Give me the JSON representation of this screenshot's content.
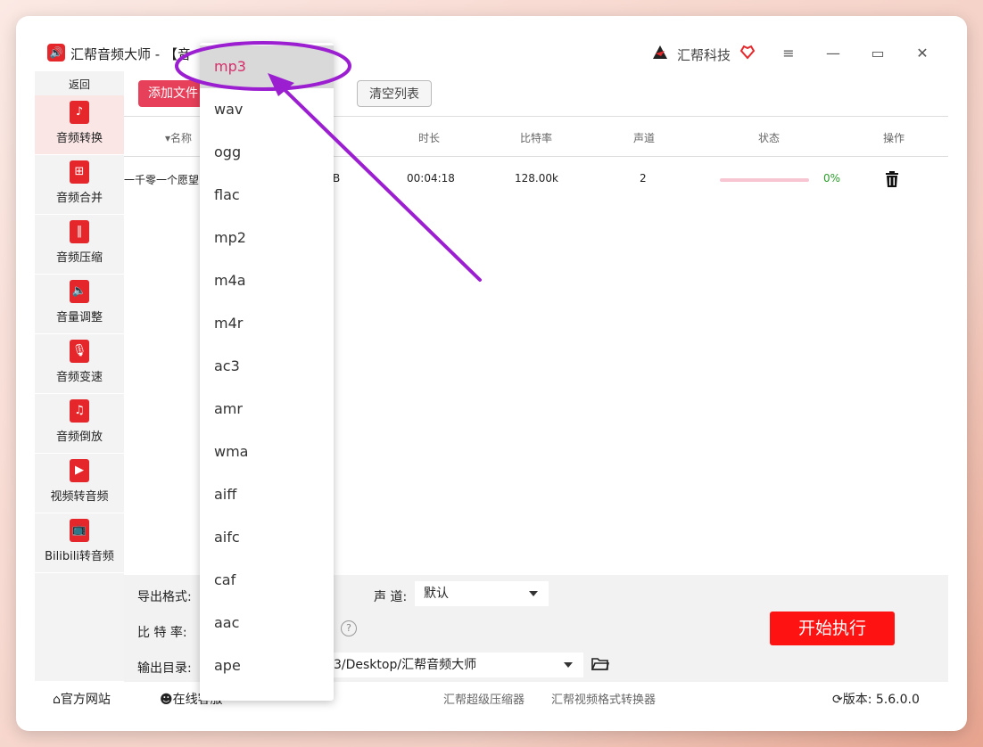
{
  "app": {
    "title": "汇帮音频大师 - 【音",
    "brand_name": "汇帮科技",
    "logo_glyph": "🔊"
  },
  "window_controls": {
    "menu": "≡",
    "minimize": "—",
    "maximize": "▭",
    "close": "✕"
  },
  "sidebar": {
    "back_label": "返回",
    "items": [
      {
        "label": "音频转换",
        "icon": "audio-convert-icon",
        "glyph": "♪",
        "active": true
      },
      {
        "label": "音频合并",
        "icon": "audio-merge-icon",
        "glyph": "⊞"
      },
      {
        "label": "音频压缩",
        "icon": "audio-compress-icon",
        "glyph": "‖"
      },
      {
        "label": "音量调整",
        "icon": "volume-adjust-icon",
        "glyph": "🔈"
      },
      {
        "label": "音频变速",
        "icon": "audio-speed-icon",
        "glyph": "🎙"
      },
      {
        "label": "音频倒放",
        "icon": "audio-reverse-icon",
        "glyph": "♫"
      },
      {
        "label": "视频转音频",
        "icon": "video-to-audio-icon",
        "glyph": "▶"
      },
      {
        "label": "Bilibili转音频",
        "icon": "bilibili-icon",
        "glyph": "📺"
      }
    ]
  },
  "toolbar": {
    "add_label": "添加文件",
    "clear_label": "清空列表"
  },
  "table": {
    "headers": {
      "name": "▾名称",
      "duration": "时长",
      "bitrate": "比特率",
      "channel": "声道",
      "status": "状态",
      "action": "操作"
    },
    "row": {
      "name": "一千零一个愿望",
      "size": "B",
      "duration": "00:04:18",
      "bitrate": "128.00k",
      "channel": "2",
      "progress_percent": 0,
      "progress_label": "0%"
    }
  },
  "settings": {
    "format_label": "导出格式:",
    "channel_label": "声 道:",
    "channel_value": "默认",
    "bitrate_label": "比 特 率:",
    "output_label": "输出目录:",
    "output_value": "3/Desktop/汇帮音频大师",
    "help_glyph": "?",
    "start_label": "开始执行"
  },
  "footer": {
    "website": "官方网站",
    "online": "在线客服",
    "link1": "汇帮超级压缩器",
    "link2": "汇帮视频格式转换器",
    "version": "版本: 5.6.0.0"
  },
  "format_dropdown": {
    "selected": "mp3",
    "options": [
      "mp3",
      "wav",
      "ogg",
      "flac",
      "mp2",
      "m4a",
      "m4r",
      "ac3",
      "amr",
      "wma",
      "aiff",
      "aifc",
      "caf",
      "aac",
      "ape"
    ]
  },
  "colors": {
    "accent_red": "#ff1212",
    "add_button": "#e6405a",
    "annotation_purple": "#9b1fd0",
    "selected_text": "#d72d6a"
  }
}
